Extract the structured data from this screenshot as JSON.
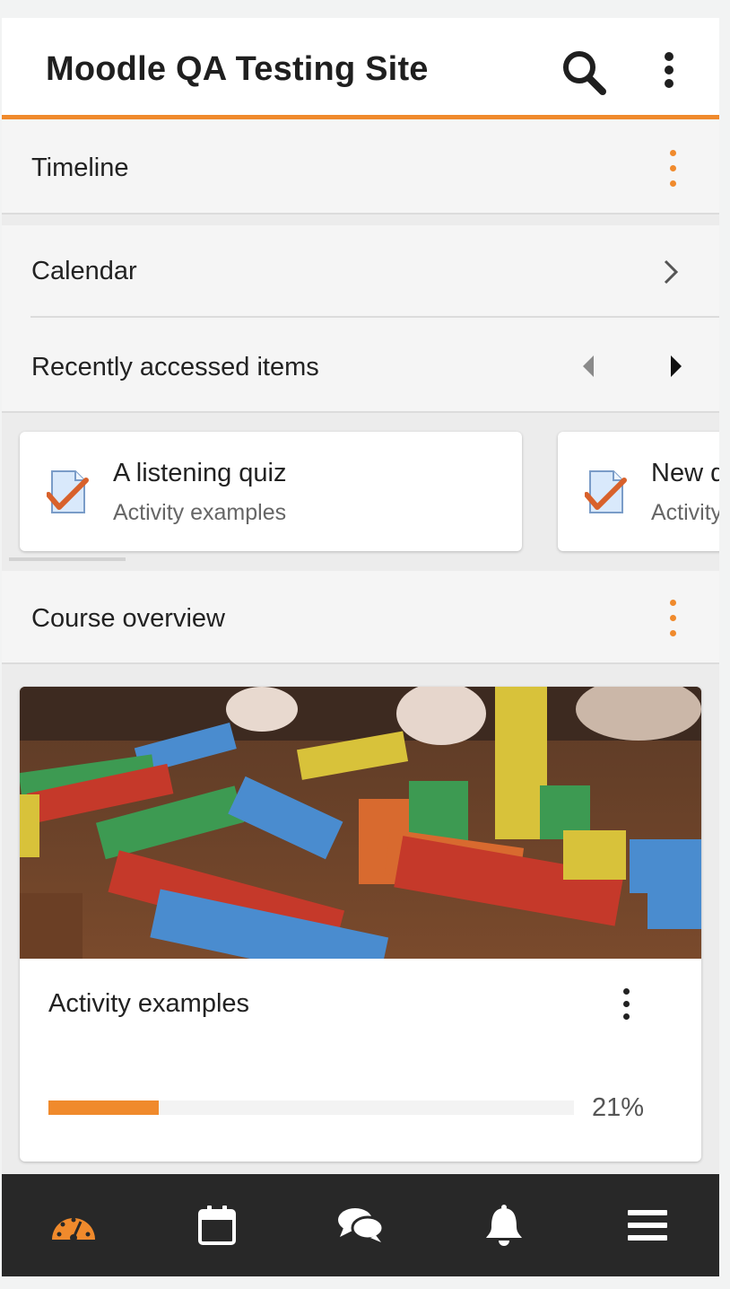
{
  "header": {
    "title": "Moodle QA Testing Site"
  },
  "timeline": {
    "title": "Timeline"
  },
  "calendar": {
    "title": "Calendar"
  },
  "recent": {
    "title": "Recently accessed items",
    "items": [
      {
        "title": "A listening quiz",
        "subtitle": "Activity examples",
        "icon": "quiz-icon"
      },
      {
        "title": "New q",
        "subtitle": "Activity",
        "icon": "quiz-icon"
      }
    ]
  },
  "course_overview": {
    "title": "Course overview",
    "courses": [
      {
        "name": "Activity examples",
        "progress_label": "21%",
        "progress": 0.21
      }
    ]
  },
  "bottom_nav": [
    {
      "name": "dashboard",
      "icon": "dashboard-icon",
      "active": true
    },
    {
      "name": "calendar",
      "icon": "calendar-icon",
      "active": false
    },
    {
      "name": "messages",
      "icon": "chat-icon",
      "active": false
    },
    {
      "name": "notifications",
      "icon": "bell-icon",
      "active": false
    },
    {
      "name": "menu",
      "icon": "hamburger-icon",
      "active": false
    }
  ],
  "colors": {
    "accent": "#f08a2c",
    "nav_bg": "#282828",
    "nav_icon": "#ffffff"
  }
}
